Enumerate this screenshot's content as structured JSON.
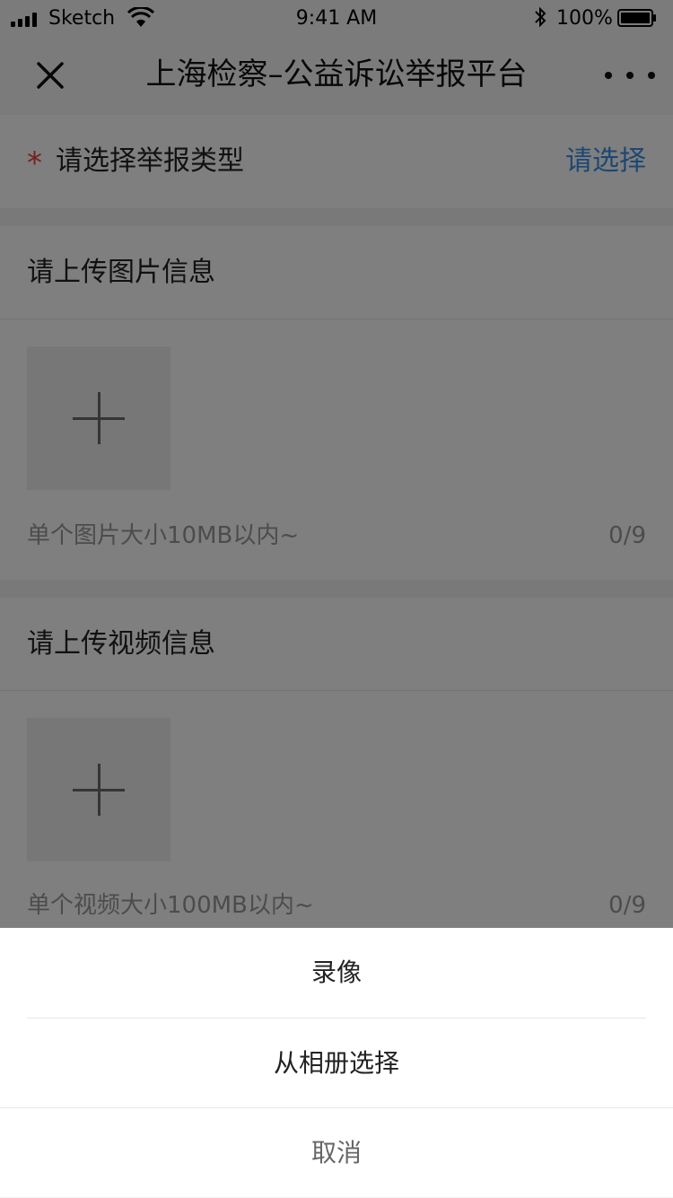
{
  "status_bar": {
    "carrier": "Sketch",
    "time": "9:41 AM",
    "battery": "100%"
  },
  "nav": {
    "title": "上海检察–公益诉讼举报平台",
    "close_icon": "close-icon",
    "more_icon": "more-icon"
  },
  "report_type": {
    "required_mark": "*",
    "label": "请选择举报类型",
    "select_label": "请选择",
    "accent_color": "#3a8ee6"
  },
  "image_section": {
    "title": "请上传图片信息",
    "hint": "单个图片大小10MB以内~",
    "counter": "0/9",
    "add_icon": "plus-icon"
  },
  "video_section": {
    "title": "请上传视频信息",
    "hint": "单个视频大小100MB以内~",
    "counter": "0/9",
    "add_icon": "plus-icon"
  },
  "action_sheet": {
    "record_label": "录像",
    "album_label": "从相册选择",
    "cancel_label": "取消"
  }
}
